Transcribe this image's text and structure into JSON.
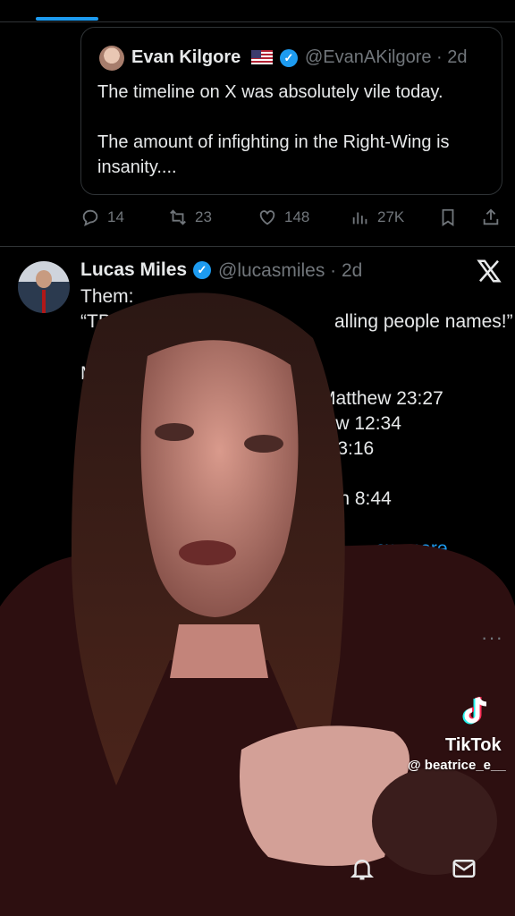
{
  "quote_tweet": {
    "name": "Evan Kilgore",
    "handle_time": "@EvanAKilgore · 2d",
    "text": "The timeline on X was absolutely vile today.\n\nThe amount of infighting in the Right-Wing is insanity...."
  },
  "tweet_actions": {
    "replies": "14",
    "reposts": "23",
    "likes": "148",
    "views": "27K"
  },
  "tweet": {
    "name": "Lucas Miles",
    "handle_time": "@lucasmiles · 2d",
    "lines": {
      "l1": "Them:",
      "l2": "“TPU",
      "l3": "alling people names!”",
      "l4": "M",
      "l5": "Matthew 23:27",
      "l6": "hew 12:34",
      "l7": "/ 23:16",
      "l8": "ohn 8:44"
    },
    "show_more": "ow more"
  },
  "overlay": {
    "brand": "TikTok",
    "username": "@ beatrice_e__"
  },
  "colors": {
    "accent": "#1d9bf0",
    "muted": "#71767b",
    "text": "#e7e9ea",
    "background": "#000000"
  },
  "icons": [
    "reply-icon",
    "repost-icon",
    "like-icon",
    "views-icon",
    "bookmark-icon",
    "share-icon",
    "x-logo-icon",
    "bell-icon",
    "mail-icon",
    "tiktok-logo-icon"
  ]
}
